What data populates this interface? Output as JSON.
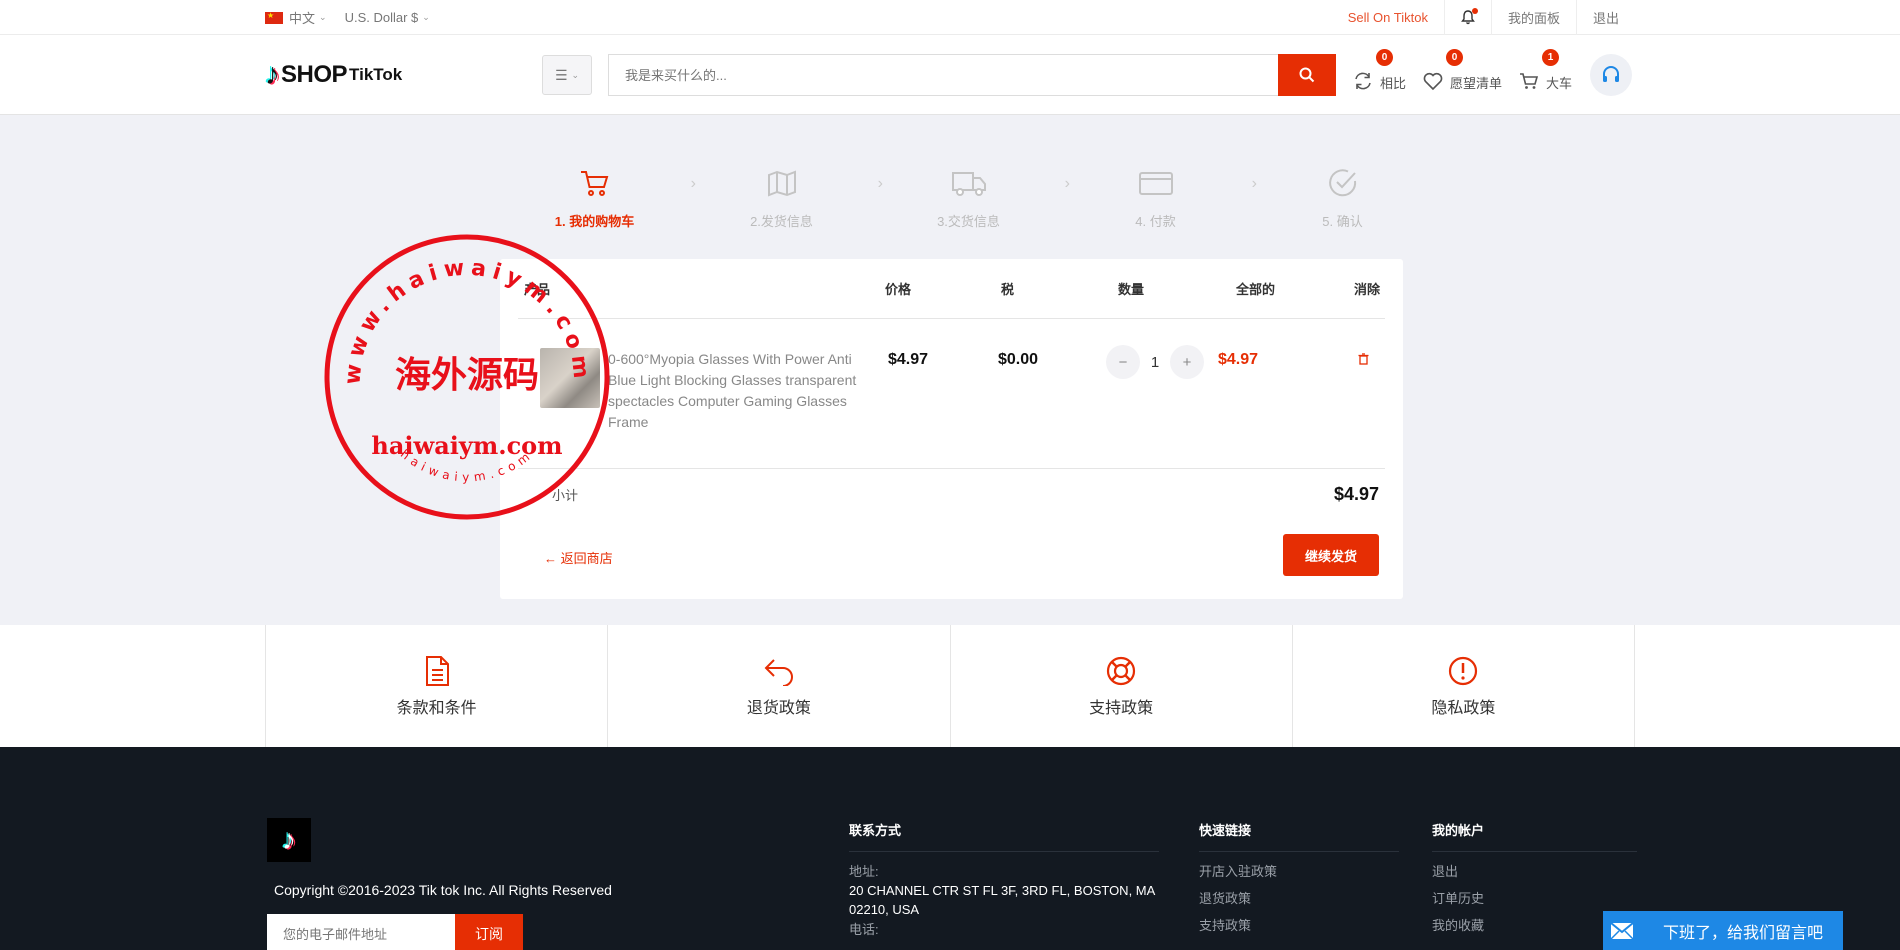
{
  "topbar": {
    "language": "中文",
    "currency": "U.S. Dollar $",
    "sell_link": "Sell On Tiktok",
    "dashboard": "我的面板",
    "logout": "退出"
  },
  "header": {
    "logo_shop": "SHOP",
    "logo_tiktok": "TikTok",
    "search_placeholder": "我是来买什么的...",
    "compare_label": "相比",
    "compare_count": "0",
    "wishlist_label": "愿望清单",
    "wishlist_count": "0",
    "cart_label": "大车",
    "cart_count": "1"
  },
  "steps": [
    {
      "label": "1. 我的购物车",
      "active": true,
      "icon": "cart-icon"
    },
    {
      "label": "2.发货信息",
      "active": false,
      "icon": "map-icon"
    },
    {
      "label": "3.交货信息",
      "active": false,
      "icon": "truck-icon"
    },
    {
      "label": "4. 付款",
      "active": false,
      "icon": "card-icon"
    },
    {
      "label": "5. 确认",
      "active": false,
      "icon": "check-circle-icon"
    }
  ],
  "cart": {
    "columns": {
      "product": "产品",
      "price": "价格",
      "tax": "税",
      "quantity": "数量",
      "total": "全部的",
      "remove": "消除"
    },
    "items": [
      {
        "name": "0-600°Myopia Glasses With Power Anti Blue Light Blocking Glasses transparent spectacles Computer Gaming Glasses Frame",
        "price": "$4.97",
        "tax": "$0.00",
        "quantity": "1",
        "total": "$4.97"
      }
    ],
    "subtotal_label": "小计",
    "subtotal_value": "$4.97",
    "back_link": "返回商店",
    "continue_button": "继续发货"
  },
  "stamp": {
    "arc_top": "www.haiwaiym.com",
    "center": "海外源码",
    "domain": "haiwaiym.com",
    "arc_bottom": "haiwaiym.com"
  },
  "policies": [
    {
      "label": "条款和条件",
      "icon": "document-icon"
    },
    {
      "label": "退货政策",
      "icon": "return-icon"
    },
    {
      "label": "支持政策",
      "icon": "lifebuoy-icon"
    },
    {
      "label": "隐私政策",
      "icon": "alert-circle-icon"
    }
  ],
  "footer": {
    "copyright": "Copyright ©2016-2023 Tik tok Inc. All Rights Reserved",
    "email_placeholder": "您的电子邮件地址",
    "subscribe": "订阅",
    "contact_title": "联系方式",
    "address_label": "地址:",
    "address": "20 CHANNEL CTR ST FL 3F, 3RD FL, BOSTON, MA 02210, USA",
    "phone_label": "电话:",
    "quick_title": "快速链接",
    "quick_links": [
      "开店入驻政策",
      "退货政策",
      "支持政策"
    ],
    "account_title": "我的帐户",
    "account_links": [
      "退出",
      "订单历史",
      "我的收藏"
    ]
  },
  "chat_widget": "下班了，给我们留言吧",
  "colors": {
    "accent": "#e62e04",
    "footer_bg": "#131921",
    "page_bg": "#f0f1f6",
    "chat_blue": "#1e88e5"
  }
}
